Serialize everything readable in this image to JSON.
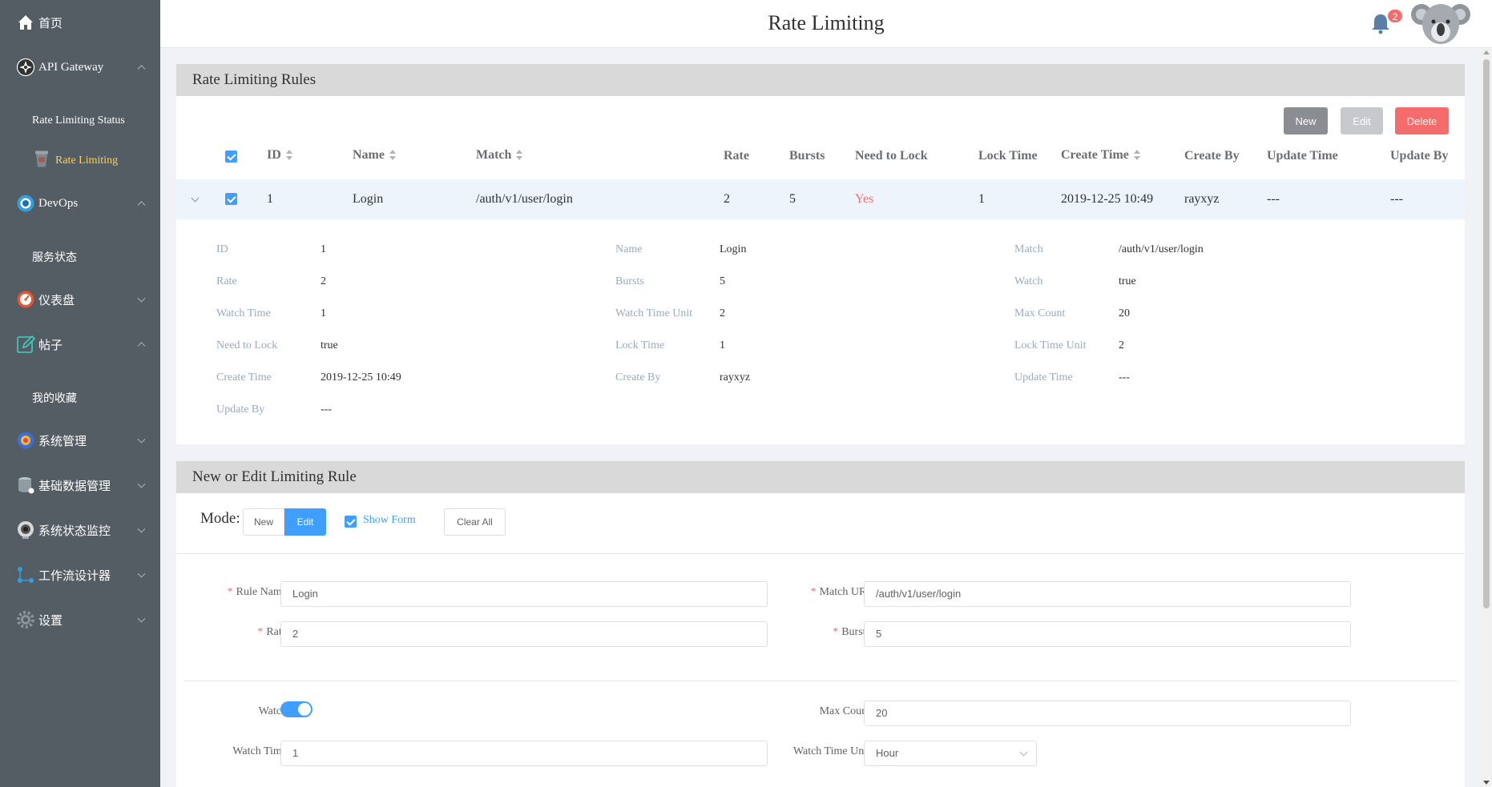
{
  "sidebar": {
    "home": "首页",
    "api_gateway": "API Gateway",
    "rate_limiting_status": "Rate Limiting Status",
    "rate_limiting": "Rate Limiting",
    "devops": "DevOps",
    "service_status": "服务状态",
    "dashboard": "仪表盘",
    "posts": "帖子",
    "my_favorites": "我的收藏",
    "system_management": "系统管理",
    "basic_data_management": "基础数据管理",
    "system_status_monitor": "系统状态监控",
    "workflow_designer": "工作流设计器",
    "settings": "设置"
  },
  "header": {
    "title": "Rate Limiting",
    "notification_count": "2"
  },
  "rules_panel": {
    "title": "Rate Limiting Rules",
    "buttons": {
      "new": "New",
      "edit": "Edit",
      "delete": "Delete"
    },
    "columns": {
      "id": "ID",
      "name": "Name",
      "match": "Match",
      "rate": "Rate",
      "bursts": "Bursts",
      "need_to_lock": "Need to Lock",
      "lock_time": "Lock Time",
      "create_time": "Create Time",
      "create_by": "Create By",
      "update_time": "Update Time",
      "update_by": "Update By"
    },
    "row": {
      "id": "1",
      "name": "Login",
      "match": "/auth/v1/user/login",
      "rate": "2",
      "bursts": "5",
      "need_to_lock": "Yes",
      "lock_time": "1",
      "create_time": "2019-12-25 10:49",
      "create_by": "rayxyz",
      "update_time": "---",
      "update_by": "---"
    },
    "details": [
      {
        "label": "ID",
        "value": "1"
      },
      {
        "label": "Name",
        "value": "Login"
      },
      {
        "label": "Match",
        "value": "/auth/v1/user/login"
      },
      {
        "label": "Rate",
        "value": "2"
      },
      {
        "label": "Bursts",
        "value": "5"
      },
      {
        "label": "Watch",
        "value": "true"
      },
      {
        "label": "Watch Time",
        "value": "1"
      },
      {
        "label": "Watch Time Unit",
        "value": "2"
      },
      {
        "label": "Max Count",
        "value": "20"
      },
      {
        "label": "Need to Lock",
        "value": "true"
      },
      {
        "label": "Lock Time",
        "value": "1"
      },
      {
        "label": "Lock Time Unit",
        "value": "2"
      },
      {
        "label": "Create Time",
        "value": "2019-12-25 10:49"
      },
      {
        "label": "Create By",
        "value": "rayxyz"
      },
      {
        "label": "Update Time",
        "value": "---"
      },
      {
        "label": "Update By",
        "value": "---"
      }
    ]
  },
  "form_panel": {
    "title": "New or Edit Limiting Rule",
    "mode_label": "Mode:",
    "mode_new": "New",
    "mode_edit": "Edit",
    "show_form": "Show Form",
    "clear_all": "Clear All",
    "fields": {
      "rule_name": {
        "label": "Rule Name",
        "value": "Login"
      },
      "match_uri": {
        "label": "Match URI",
        "value": "/auth/v1/user/login"
      },
      "rate": {
        "label": "Rate",
        "value": "2"
      },
      "bursts": {
        "label": "Bursts",
        "value": "5"
      },
      "watch": {
        "label": "Watch",
        "on": true
      },
      "max_count": {
        "label": "Max Count",
        "value": "20"
      },
      "watch_time": {
        "label": "Watch Time",
        "value": "1"
      },
      "watch_time_unit": {
        "label": "Watch Time Unit",
        "value": "Hour"
      }
    }
  },
  "colors": {
    "sidebar_bg": "#545c64",
    "active_menu": "#ffd04b",
    "primary": "#409eff",
    "danger": "#f56c6c"
  }
}
